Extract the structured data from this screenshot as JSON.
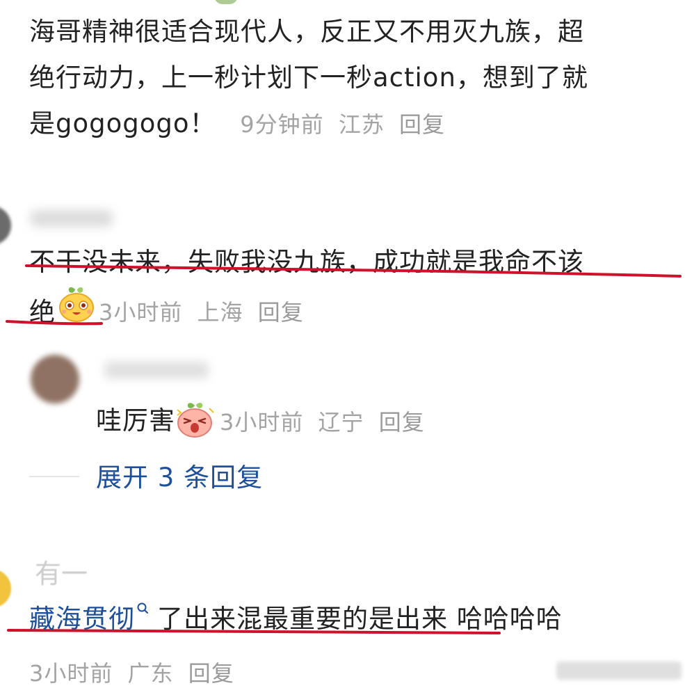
{
  "comments": [
    {
      "text_lines": [
        "海哥精神很适合现代人，反正又不用灭九族，超",
        "绝行动力，上一秒计划下一秒action，想到了就",
        "是gogogogo！"
      ],
      "time": "9分钟前",
      "location": "江苏",
      "reply_label": "回复"
    },
    {
      "text_lines": [
        "不干没未来，失败我没九族，成功就是我命不该",
        "绝"
      ],
      "emoji": "happy-sprout-emoji",
      "time": "3小时前",
      "location": "上海",
      "reply_label": "回复"
    },
    {
      "reply_text": "哇厉害",
      "emoji": "shocked-sprout-emoji",
      "time": "3小时前",
      "location": "辽宁",
      "reply_label": "回复"
    },
    {
      "username_partial": "有一",
      "link_text": "藏海贯彻",
      "text_rest": "了出来混最重要的是出来 哈哈哈哈",
      "time": "3小时前",
      "location": "广东",
      "reply_label": "回复"
    }
  ],
  "expand_replies": "展开 3 条回复",
  "accent_color": "#1d4f9a",
  "highlight_color": "#d0112b"
}
